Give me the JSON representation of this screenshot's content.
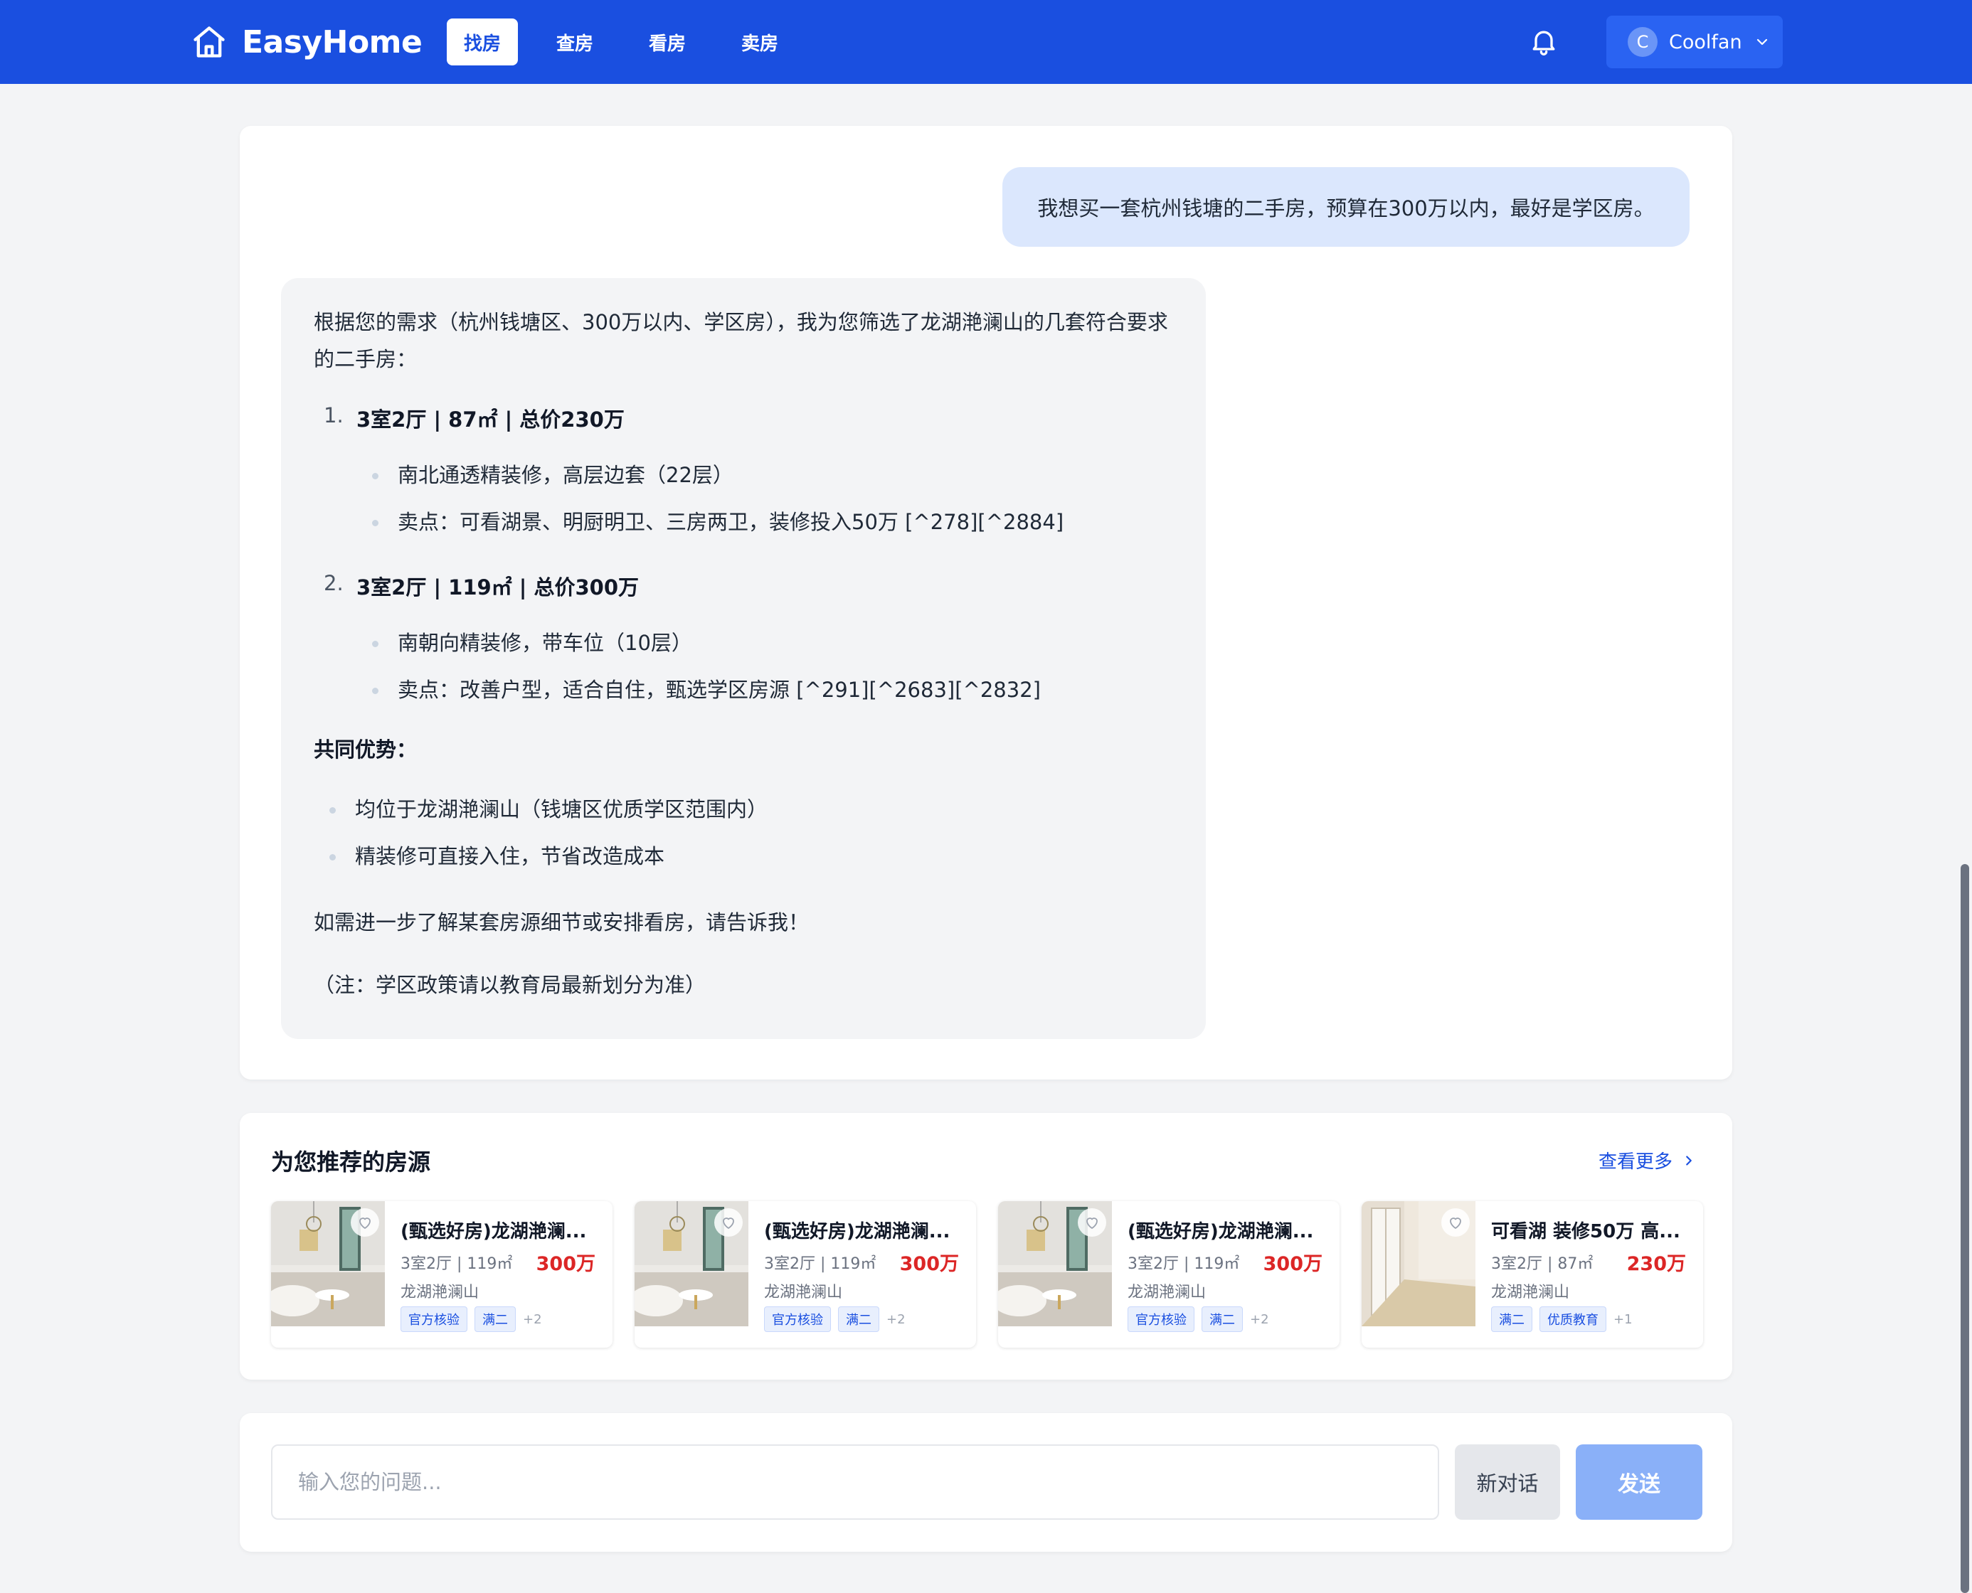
{
  "brand": {
    "name": "EasyHome"
  },
  "nav": {
    "items": [
      {
        "label": "找房",
        "active": true
      },
      {
        "label": "查房"
      },
      {
        "label": "看房"
      },
      {
        "label": "卖房"
      }
    ]
  },
  "user": {
    "initial": "C",
    "name": "Coolfan"
  },
  "chat": {
    "user_message": "我想买一套杭州钱塘的二手房，预算在300万以内，最好是学区房。",
    "ai": {
      "intro": "根据您的需求（杭州钱塘区、300万以内、学区房），我为您筛选了龙湖滟澜山的几套符合要求的二手房：",
      "listings": [
        {
          "num": "1.",
          "title": "3室2厅 | 87㎡ | 总价230万",
          "points": [
            "南北通透精装修，高层边套（22层）",
            "卖点：可看湖景、明厨明卫、三房两卫，装修投入50万 [^278][^2884]"
          ]
        },
        {
          "num": "2.",
          "title": "3室2厅 | 119㎡ | 总价300万",
          "points": [
            "南朝向精装修，带车位（10层）",
            "卖点：改善户型，适合自住，甄选学区房源 [^291][^2683][^2832]"
          ]
        }
      ],
      "advantages_title": "共同优势：",
      "advantages": [
        "均位于龙湖滟澜山（钱塘区优质学区范围内）",
        "精装修可直接入住，节省改造成本"
      ],
      "closing": "如需进一步了解某套房源细节或安排看房，请告诉我！",
      "note": "（注：学区政策请以教育局最新划分为准）"
    }
  },
  "recommend": {
    "title": "为您推荐的房源",
    "more": "查看更多",
    "cards": [
      {
        "title": "(甄选好房)龙湖滟澜...",
        "spec": "3室2厅 | 119㎡",
        "price": "300万",
        "community": "龙湖滟澜山",
        "tags": [
          "官方核验",
          "满二"
        ],
        "more": "+2"
      },
      {
        "title": "(甄选好房)龙湖滟澜...",
        "spec": "3室2厅 | 119㎡",
        "price": "300万",
        "community": "龙湖滟澜山",
        "tags": [
          "官方核验",
          "满二"
        ],
        "more": "+2"
      },
      {
        "title": "(甄选好房)龙湖滟澜...",
        "spec": "3室2厅 | 119㎡",
        "price": "300万",
        "community": "龙湖滟澜山",
        "tags": [
          "官方核验",
          "满二"
        ],
        "more": "+2"
      },
      {
        "title": "可看湖 装修50万 高...",
        "spec": "3室2厅 | 87㎡",
        "price": "230万",
        "community": "龙湖滟澜山",
        "tags": [
          "满二",
          "优质教育"
        ],
        "more": "+1"
      }
    ]
  },
  "input": {
    "placeholder": "输入您的问题...",
    "new_chat": "新对话",
    "send": "发送"
  },
  "colors": {
    "brand": "#1a4fe0",
    "price": "#dc2626",
    "user_bubble": "#dbe7fd",
    "send_disabled": "#8ab0f8"
  }
}
